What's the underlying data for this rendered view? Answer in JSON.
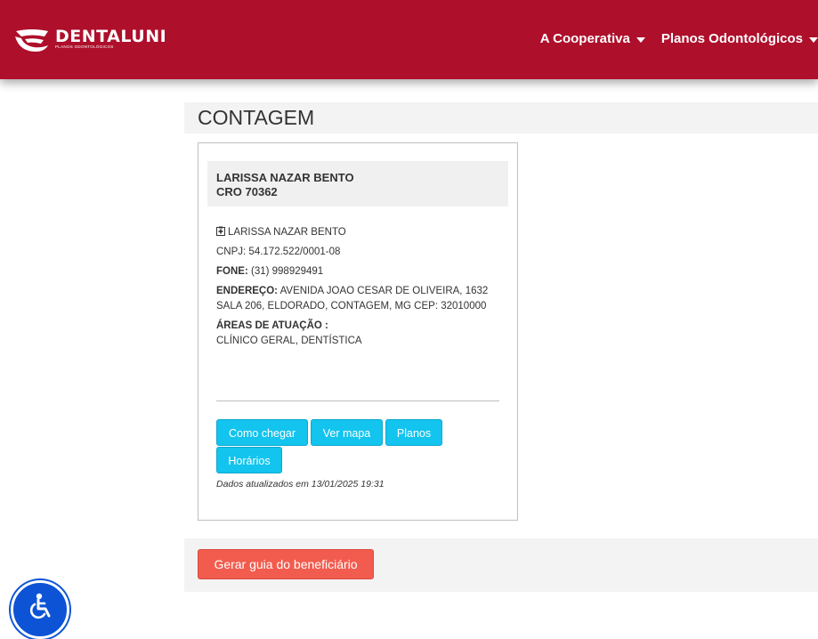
{
  "brand": {
    "name": "DENTALUNI",
    "subtitle": "PLANOS ODONTOLÓGICOS"
  },
  "nav": {
    "items": [
      {
        "label": "A Cooperativa"
      },
      {
        "label": "Planos Odontológicos"
      }
    ]
  },
  "city": {
    "title": "CONTAGEM"
  },
  "card": {
    "name": "LARISSA NAZAR BENTO",
    "cro": "CRO 70362",
    "clinic_name": "LARISSA NAZAR BENTO",
    "cnpj": "CNPJ: 54.172.522/0001-08",
    "phone_label": "FONE:",
    "phone": "(31) 998929491",
    "address_label": "ENDEREÇO:",
    "address": "AVENIDA JOAO CESAR DE OLIVEIRA, 1632 SALA 206, ELDORADO, CONTAGEM, MG CEP: 32010000",
    "areas_label": "ÁREAS DE ATUAÇÃO :",
    "areas": "CLÍNICO GERAL, DENTÍSTICA",
    "buttons": {
      "directions": "Como chegar",
      "map": "Ver mapa",
      "plans": "Planos",
      "hours": "Horários"
    },
    "updated": "Dados atualizados em 13/01/2025 19:31"
  },
  "footer": {
    "guide_button": "Gerar guia do beneficiário"
  },
  "icons": {
    "clinic": "clinic-icon",
    "accessibility": "wheelchair-icon",
    "dropdown": "caret-down-icon"
  },
  "colors": {
    "navbar": "#ae0f2b",
    "button_primary": "#12c4ee",
    "button_guide": "#f25c4e",
    "accessibility": "#0c53d6"
  }
}
